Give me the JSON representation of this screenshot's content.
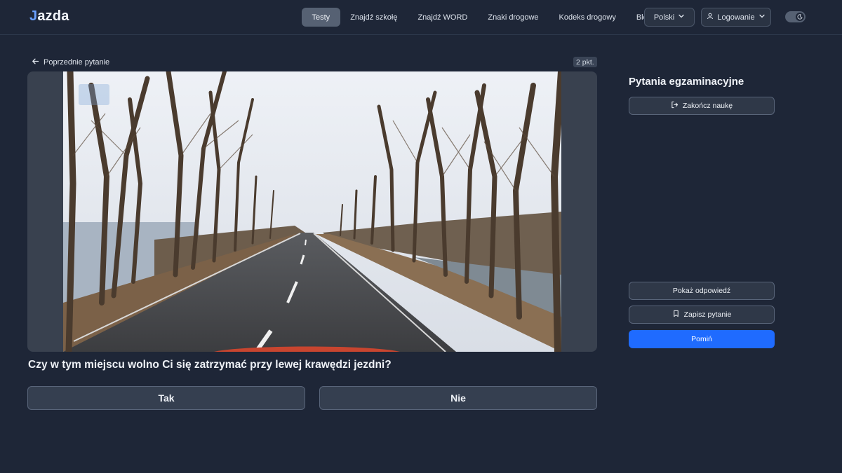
{
  "brand": {
    "logo_mark": "J",
    "logo_text": "azda"
  },
  "nav": [
    {
      "label": "Testy",
      "active": true
    },
    {
      "label": "Znajdź szkołę"
    },
    {
      "label": "Znajdź WORD"
    },
    {
      "label": "Znaki drogowe"
    },
    {
      "label": "Kodeks drogowy"
    },
    {
      "label": "Blog"
    }
  ],
  "language": {
    "selected": "Polski"
  },
  "login": {
    "label": "Logowanie"
  },
  "theme_toggle": {
    "icon": "moon-icon"
  },
  "question_area": {
    "previous_label": "Poprzednie pytanie",
    "points": "2 pkt.",
    "question_text": "Czy w tym miejscu wolno Ci się zatrzymać przy lewej krawędzi jezdni?",
    "answers": [
      "Tak",
      "Nie"
    ]
  },
  "sidebar": {
    "title": "Pytania egzaminacyjne",
    "end_label": "Zakończ naukę",
    "show_answer_label": "Pokaż odpowiedź",
    "save_label": "Zapisz pytanie",
    "skip_label": "Pomiń"
  },
  "colors": {
    "background": "#1e2637",
    "primary": "#1f6bff",
    "active_nav": "#566173"
  }
}
